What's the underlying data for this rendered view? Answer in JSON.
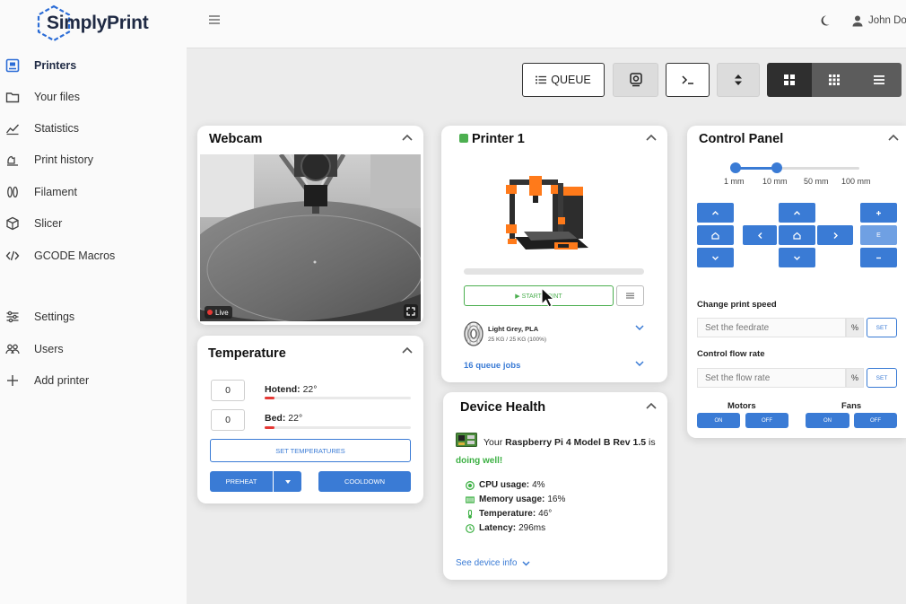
{
  "app": {
    "brand": "SimplyPrint",
    "user_name": "John Doe"
  },
  "sidebar": {
    "items": [
      {
        "label": "Printers",
        "icon": "printer-icon",
        "active": true
      },
      {
        "label": "Your files",
        "icon": "folder-icon"
      },
      {
        "label": "Statistics",
        "icon": "chart-icon"
      },
      {
        "label": "Print history",
        "icon": "history-icon"
      },
      {
        "label": "Filament",
        "icon": "filament-spool-icon"
      },
      {
        "label": "Slicer",
        "icon": "cube-icon"
      },
      {
        "label": "GCODE Macros",
        "icon": "code-icon"
      },
      {
        "label": "Settings",
        "icon": "sliders-icon"
      },
      {
        "label": "Users",
        "icon": "users-icon"
      },
      {
        "label": "Add printer",
        "icon": "plus-icon"
      }
    ]
  },
  "toolbar": {
    "queue_label": "QUEUE"
  },
  "webcam": {
    "title": "Webcam",
    "live_label": "Live"
  },
  "temperature": {
    "title": "Temperature",
    "hotend_input": "0",
    "hotend_label": "Hotend:",
    "hotend_value": "22°",
    "bed_input": "0",
    "bed_label": "Bed:",
    "bed_value": "22°",
    "set_label": "SET TEMPERATURES",
    "preheat_label": "PREHEAT",
    "cooldown_label": "COOLDOWN",
    "status_color": "#e53935"
  },
  "printer": {
    "name": "Printer 1",
    "status_color": "#4caf50",
    "start_label": "▶ START PRINT",
    "filament_name": "Light Grey, PLA",
    "filament_sub": "25 KG / 25 KG (100%)",
    "queue_jobs": "16 queue jobs"
  },
  "health": {
    "title": "Device Health",
    "prefix": "Your",
    "device": "Raspberry Pi 4 Model B Rev 1.5",
    "suffix": "is",
    "status": "doing well!",
    "cpu_label": "CPU usage:",
    "cpu_value": "4%",
    "memory_label": "Memory usage:",
    "memory_value": "16%",
    "temp_label": "Temperature:",
    "temp_value": "46°",
    "latency_label": "Latency:",
    "latency_value": "296ms",
    "see_more": "See device info"
  },
  "control": {
    "title": "Control Panel",
    "steps": [
      "1 mm",
      "10 mm",
      "50 mm",
      "100 mm"
    ],
    "selected_step": "10 mm",
    "speed_title": "Change print speed",
    "speed_placeholder": "Set the feedrate",
    "flow_title": "Control flow rate",
    "flow_placeholder": "Set the flow rate",
    "unit": "%",
    "set_label": "SET",
    "motors_label": "Motors",
    "fans_label": "Fans",
    "on_label": "ON",
    "off_label": "OFF",
    "extrude_label": "E",
    "accent": "#3a7bd5"
  }
}
